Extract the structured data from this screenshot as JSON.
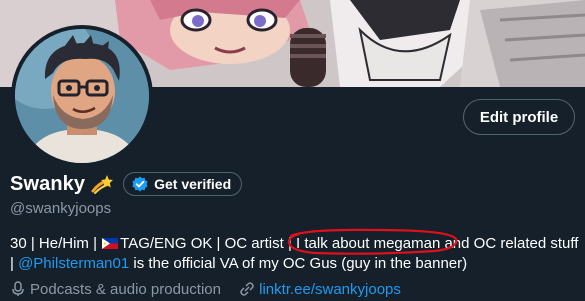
{
  "profile": {
    "display_name": "Swanky",
    "name_emoji": "shooting-star-emoji",
    "handle": "@swankyjoops",
    "edit_button_label": "Edit profile",
    "verify_label": "Get verified"
  },
  "bio": {
    "part1": "30 | He/Him | ",
    "flag": "philippines-flag-icon",
    "part2": "TAG/ENG OK | OC artist | ",
    "highlight": "I talk about megaman",
    "part3": " and OC related stuff | ",
    "mention": "@Philsterman01",
    "part4": " is the official VA of my OC Gus (guy in the banner)"
  },
  "meta": {
    "item1": "Podcasts & audio production",
    "item2": "linktr.ee/swankyjoops"
  },
  "colors": {
    "background": "#15202b",
    "secondary_text": "#8b98a5",
    "link": "#1d9bf0",
    "annotation": "#e0101a",
    "border": "#536471"
  }
}
